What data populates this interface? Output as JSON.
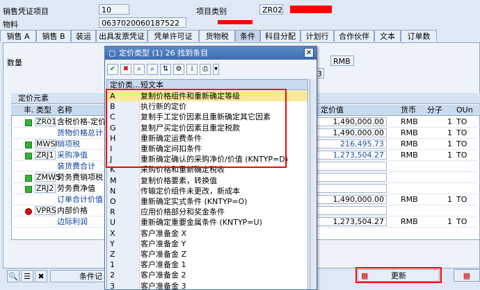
{
  "header": {
    "sales_doc_item_label": "销售凭证项目",
    "sales_doc_item_value": "10",
    "item_category_label": "项目类别",
    "item_category_value": "ZR02",
    "material_label": "物料",
    "material_value": "0637020060187522",
    "colors": {
      "redacted": "#ff0000"
    }
  },
  "tabs": [
    "销售 A",
    "销售 B",
    "装运",
    "出具发票凭证",
    "凭单许可证",
    "货物税",
    "条件",
    "科目分配",
    "计划行",
    "合作伙伴",
    "文本",
    "订单数"
  ],
  "active_tab": "条件",
  "conditions": {
    "quantity_label": "数量",
    "currency_hint": "RMB",
    "currency_hint_2": "RMB",
    "small_val": "3",
    "group_title": "定价元素",
    "columns": {
      "ind": "丰.",
      "type": "类型",
      "name": "名称",
      "amount": "定价值",
      "currency": "货币",
      "numerator": "分子",
      "uom": "OUn"
    },
    "rows": [
      {
        "status": "green",
        "type": "ZR01",
        "name": "含税价格-定价值",
        "amount": "1,490,000.00",
        "currency": "RMB",
        "num": "1",
        "uom": "TO",
        "style": "normal"
      },
      {
        "status": "",
        "type": "",
        "name": "货物价格总计",
        "amount": "1,490,000.00",
        "currency": "RMB",
        "num": "1",
        "uom": "TO",
        "style": "link"
      },
      {
        "status": "green",
        "type": "MWSI",
        "name": "销项税",
        "amount": "216,495.73",
        "currency": "RMB",
        "num": "1",
        "uom": "TO",
        "style": "blue"
      },
      {
        "status": "green",
        "type": "ZRJ1",
        "name": "采购净值",
        "amount": "1,273,504.27",
        "currency": "RMB",
        "num": "1",
        "uom": "TO",
        "style": "blue"
      },
      {
        "status": "",
        "type": "",
        "name": "装货费合计",
        "amount": "",
        "currency": "",
        "num": "",
        "uom": "",
        "style": "link"
      },
      {
        "status": "green",
        "type": "ZMW5",
        "name": "劳务费销项税",
        "amount": "",
        "currency": "",
        "num": "",
        "uom": "",
        "style": "normal"
      },
      {
        "status": "green",
        "type": "ZRJ2",
        "name": "劳务费净值",
        "amount": "",
        "currency": "",
        "num": "",
        "uom": "",
        "style": "normal"
      },
      {
        "status": "",
        "type": "",
        "name": "订单合计价值",
        "amount": "1,490,000.00",
        "currency": "RMB",
        "num": "1",
        "uom": "TO",
        "style": "link"
      },
      {
        "status": "red",
        "type": "VPRS",
        "name": "内部价格",
        "amount": "",
        "currency": "",
        "num": "",
        "uom": "",
        "style": "normal"
      },
      {
        "status": "",
        "type": "",
        "name": "边际利润",
        "amount": "1,273,504.27",
        "currency": "RMB",
        "num": "1",
        "uom": "TO",
        "style": "link"
      }
    ]
  },
  "bottom": {
    "condition_label": "条件记",
    "update_label": "更新"
  },
  "popup": {
    "title": "定价类型 (1)   26 找到条目",
    "col_key": "定价类...",
    "col_text": "短文本",
    "items": [
      {
        "key": "A",
        "text": "复制价格组件和重新确定等级"
      },
      {
        "key": "B",
        "text": "执行新的定价"
      },
      {
        "key": "C",
        "text": "复制手工定价因素且重新确定其它因素"
      },
      {
        "key": "G",
        "text": "复制尸买定价因素且重定税款"
      },
      {
        "key": "H",
        "text": "重新确定运费条件"
      },
      {
        "key": "I",
        "text": "重新确定间扣条件"
      },
      {
        "key": "J",
        "text": "重新确定确认的采购净价/价值 (KNTYP=D)"
      },
      {
        "key": "K",
        "text": "采购价格和重新确定税收"
      },
      {
        "key": "M",
        "text": "复制价格要素，转换值"
      },
      {
        "key": "N",
        "text": "传输定价组件未更改，新成本"
      },
      {
        "key": "O",
        "text": "重新确定实式条件 (KNTYP=O)"
      },
      {
        "key": "R",
        "text": "应用价格部分和奖金条件"
      },
      {
        "key": "U",
        "text": "重新确定重要金属条件 (KNTYP=U)"
      },
      {
        "key": "X",
        "text": "客户准备金 X"
      },
      {
        "key": "Y",
        "text": "客户准备金 Y"
      },
      {
        "key": "Z",
        "text": "客户准备金 Z"
      },
      {
        "key": "1",
        "text": "客户准备金 1"
      },
      {
        "key": "2",
        "text": "客户准备金 2"
      },
      {
        "key": "3",
        "text": "客户准备金 3"
      }
    ]
  }
}
